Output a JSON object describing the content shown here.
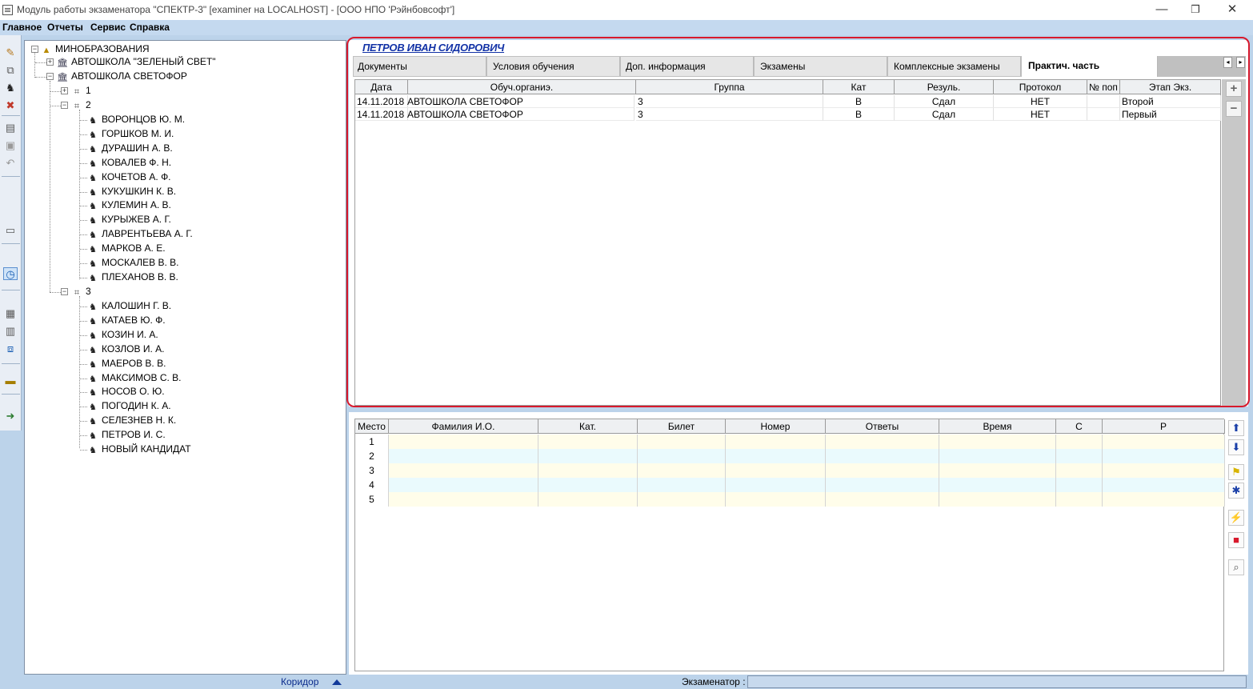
{
  "window": {
    "title": "Модуль работы экзаменатора \"СПЕКТР-3\" [examiner на LOCALHOST] - [ООО НПО 'Рэйнбовсофт']",
    "minimize": "—",
    "restore": "❐",
    "close": "✕"
  },
  "menu": [
    "Главное",
    "Отчеты",
    "Сервис",
    "Справка"
  ],
  "toolbar_icons": [
    "edit-icon",
    "zoom-icon",
    "person-icon",
    "delete-icon",
    "document-icon",
    "save-icon",
    "undo-icon",
    "window-icon",
    "clock-icon",
    "monitor-icon",
    "book-icon",
    "copy-icon",
    "car-icon",
    "exit-icon"
  ],
  "tree": {
    "root": "МИНОБРАЗОВАНИЯ",
    "school1": "АВТОШКОЛА \"ЗЕЛЕНЫЙ СВЕТ\"",
    "school2": "АВТОШКОЛА СВЕТОФОР",
    "group1": "1",
    "group2": "2",
    "group2_members": [
      "ВОРОНЦОВ Ю. М.",
      "ГОРШКОВ М. И.",
      "ДУРАШИН А. В.",
      "КОВАЛЕВ Ф. Н.",
      "КОЧЕТОВ А. Ф.",
      "КУКУШКИН К. В.",
      "КУЛЕМИН А. В.",
      "КУРЫЖЕВ А. Г.",
      "ЛАВРЕНТЬЕВА А. Г.",
      "МАРКОВ А. Е.",
      "МОСКАЛЕВ В. В.",
      "ПЛЕХАНОВ В. В."
    ],
    "group3": "3",
    "group3_members": [
      "КАЛОШИН Г. В.",
      "КАТАЕВ Ю. Ф.",
      "КОЗИН И. А.",
      "КОЗЛОВ И. А.",
      "МАЕРОВ В. В.",
      "МАКСИМОВ С. В.",
      "НОСОВ О. Ю.",
      "ПОГОДИН К. А.",
      "СЕЛЕЗНЕВ Н. К.",
      "ПЕТРОВ И. С.",
      "НОВЫЙ КАНДИДАТ"
    ]
  },
  "status": {
    "corridor": "Коридор",
    "examiner_label": "Экзаменатор :",
    "examiner_value": ""
  },
  "candidate": {
    "name": "ПЕТРОВ ИВАН СИДОРОВИЧ",
    "tabs": [
      "Документы",
      "Условия обучения",
      "Доп. информация",
      "Экзамены",
      "Комплексные экзамены",
      "Практич. часть"
    ],
    "active_tab": "Практич. часть"
  },
  "practical_grid": {
    "columns": [
      "Дата",
      "Обуч.органиэ.",
      "Группа",
      "Кат",
      "Резуль.",
      "Протокол",
      "№ поп",
      "Этап Экз."
    ],
    "rows": [
      [
        "14.11.2018",
        "АВТОШКОЛА СВЕТОФОР",
        "3",
        "B",
        "Сдал",
        "НЕТ",
        "",
        "Второй"
      ],
      [
        "14.11.2018",
        "АВТОШКОЛА СВЕТОФОР",
        "3",
        "B",
        "Сдал",
        "НЕТ",
        "",
        "Первый"
      ]
    ],
    "side_buttons": [
      "+",
      "−"
    ]
  },
  "seats_grid": {
    "columns": [
      "Место",
      "Фамилия И.О.",
      "Кат.",
      "Билет",
      "Номер",
      "Ответы",
      "Время",
      "С",
      "Р"
    ],
    "rows": [
      "1",
      "2",
      "3",
      "4",
      "5"
    ],
    "row_colors": [
      "#fffdea",
      "#eafafd"
    ]
  },
  "right_icons": [
    "arrow-up-icon",
    "arrow-down-icon",
    "flag-icon",
    "puzzle-icon",
    "lightning-icon",
    "stop-icon",
    "magnifier-icon"
  ]
}
